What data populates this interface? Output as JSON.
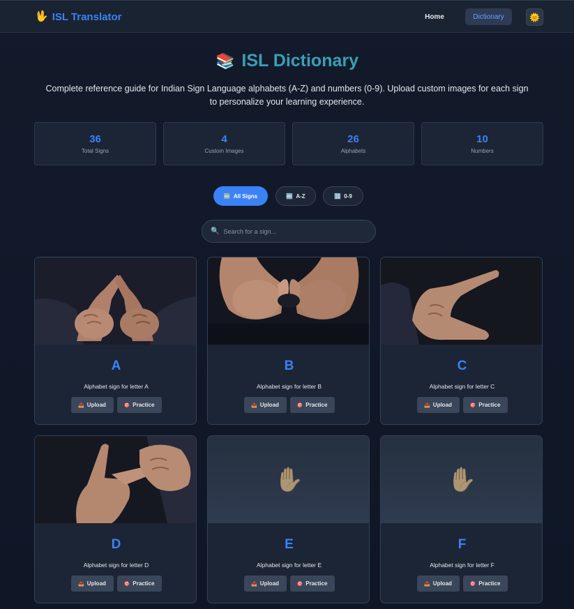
{
  "nav": {
    "brand_icon": "🖖",
    "brand": "ISL Translator",
    "home": "Home",
    "dictionary": "Dictionary",
    "theme_icon": "🌞"
  },
  "hero": {
    "icon": "📚",
    "title": "ISL Dictionary",
    "subtitle": "Complete reference guide for Indian Sign Language alphabets (A-Z) and numbers (0-9). Upload custom images for each sign to personalize your learning experience."
  },
  "stats": [
    {
      "value": "36",
      "label": "Total Signs"
    },
    {
      "value": "4",
      "label": "Custom Images"
    },
    {
      "value": "26",
      "label": "Alphabets"
    },
    {
      "value": "10",
      "label": "Numbers"
    }
  ],
  "filters": [
    {
      "icon": "🔤",
      "label": "All Signs",
      "active": true
    },
    {
      "icon": "🔤",
      "label": "A-Z",
      "active": false
    },
    {
      "icon": "🔢",
      "label": "0-9",
      "active": false
    }
  ],
  "search": {
    "icon": "🔍",
    "placeholder": "Search for a sign..."
  },
  "card_buttons": {
    "upload_icon": "📤",
    "upload": "Upload",
    "practice_icon": "🎯",
    "practice": "Practice"
  },
  "cards": [
    {
      "letter": "A",
      "desc": "Alphabet sign for letter A",
      "image": "photo"
    },
    {
      "letter": "B",
      "desc": "Alphabet sign for letter B",
      "image": "photo"
    },
    {
      "letter": "C",
      "desc": "Alphabet sign for letter C",
      "image": "photo"
    },
    {
      "letter": "D",
      "desc": "Alphabet sign for letter D",
      "image": "photo"
    },
    {
      "letter": "E",
      "desc": "Alphabet sign for letter E",
      "image": "placeholder",
      "placeholder_icon": "✋"
    },
    {
      "letter": "F",
      "desc": "Alphabet sign for letter F",
      "image": "placeholder",
      "placeholder_icon": "✋"
    }
  ],
  "colors": {
    "accent": "#3b82f6",
    "title": "#3a9fb5",
    "card_bg": "#1c2535",
    "page_bg": "#121a2b"
  }
}
